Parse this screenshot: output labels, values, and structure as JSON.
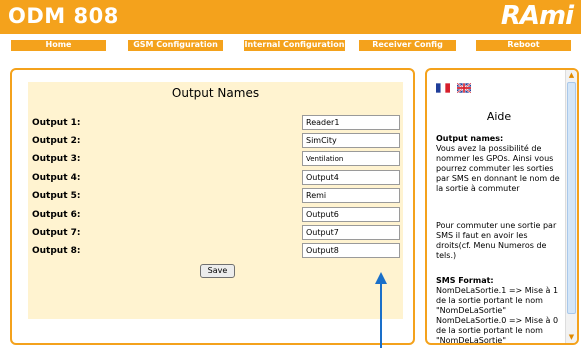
{
  "header": {
    "product_name": "ODM 808",
    "logo_text": "RAmi"
  },
  "nav": {
    "items": [
      {
        "label": "Home"
      },
      {
        "label": "GSM Configuration"
      },
      {
        "label": "Internal Configuration"
      },
      {
        "label": "Receiver Config"
      },
      {
        "label": "Reboot"
      }
    ]
  },
  "form": {
    "title": "Output Names",
    "rows": [
      {
        "label": "Output 1:",
        "value": "Reader1"
      },
      {
        "label": "Output 2:",
        "value": "SimCity"
      },
      {
        "label": "Output 3:",
        "value": "Ventilation"
      },
      {
        "label": "Output 4:",
        "value": "Output4"
      },
      {
        "label": "Output 5:",
        "value": "Remi"
      },
      {
        "label": "Output 6:",
        "value": "Output6"
      },
      {
        "label": "Output 7:",
        "value": "Output7"
      },
      {
        "label": "Output 8:",
        "value": "Output8"
      }
    ],
    "save_label": "Save"
  },
  "help": {
    "flags": [
      "french-flag-icon",
      "uk-flag-icon"
    ],
    "title": "Aide",
    "section1_heading": "Output names:",
    "section1_text": "Vous avez la possibilité de nommer les GPOs. Ainsi vous pourrez commuter les sorties par SMS en donnant le nom de la sortie à commuter",
    "section2_text": "Pour commuter une sortie par SMS il faut en avoir les droits(cf. Menu Numeros de tels.)",
    "section3_heading": "SMS Format:",
    "section3_text": "NomDeLaSortie.1 => Mise à 1 de la sortie portant le nom \"NomDeLaSortie\"\nNomDeLaSortie.0 => Mise à 0 de la sortie portant le nom \"NomDeLaSortie\""
  },
  "colors": {
    "accent": "#f4a21c",
    "form_background": "#fff3d0",
    "annotation_arrow": "#1a6fc9"
  }
}
